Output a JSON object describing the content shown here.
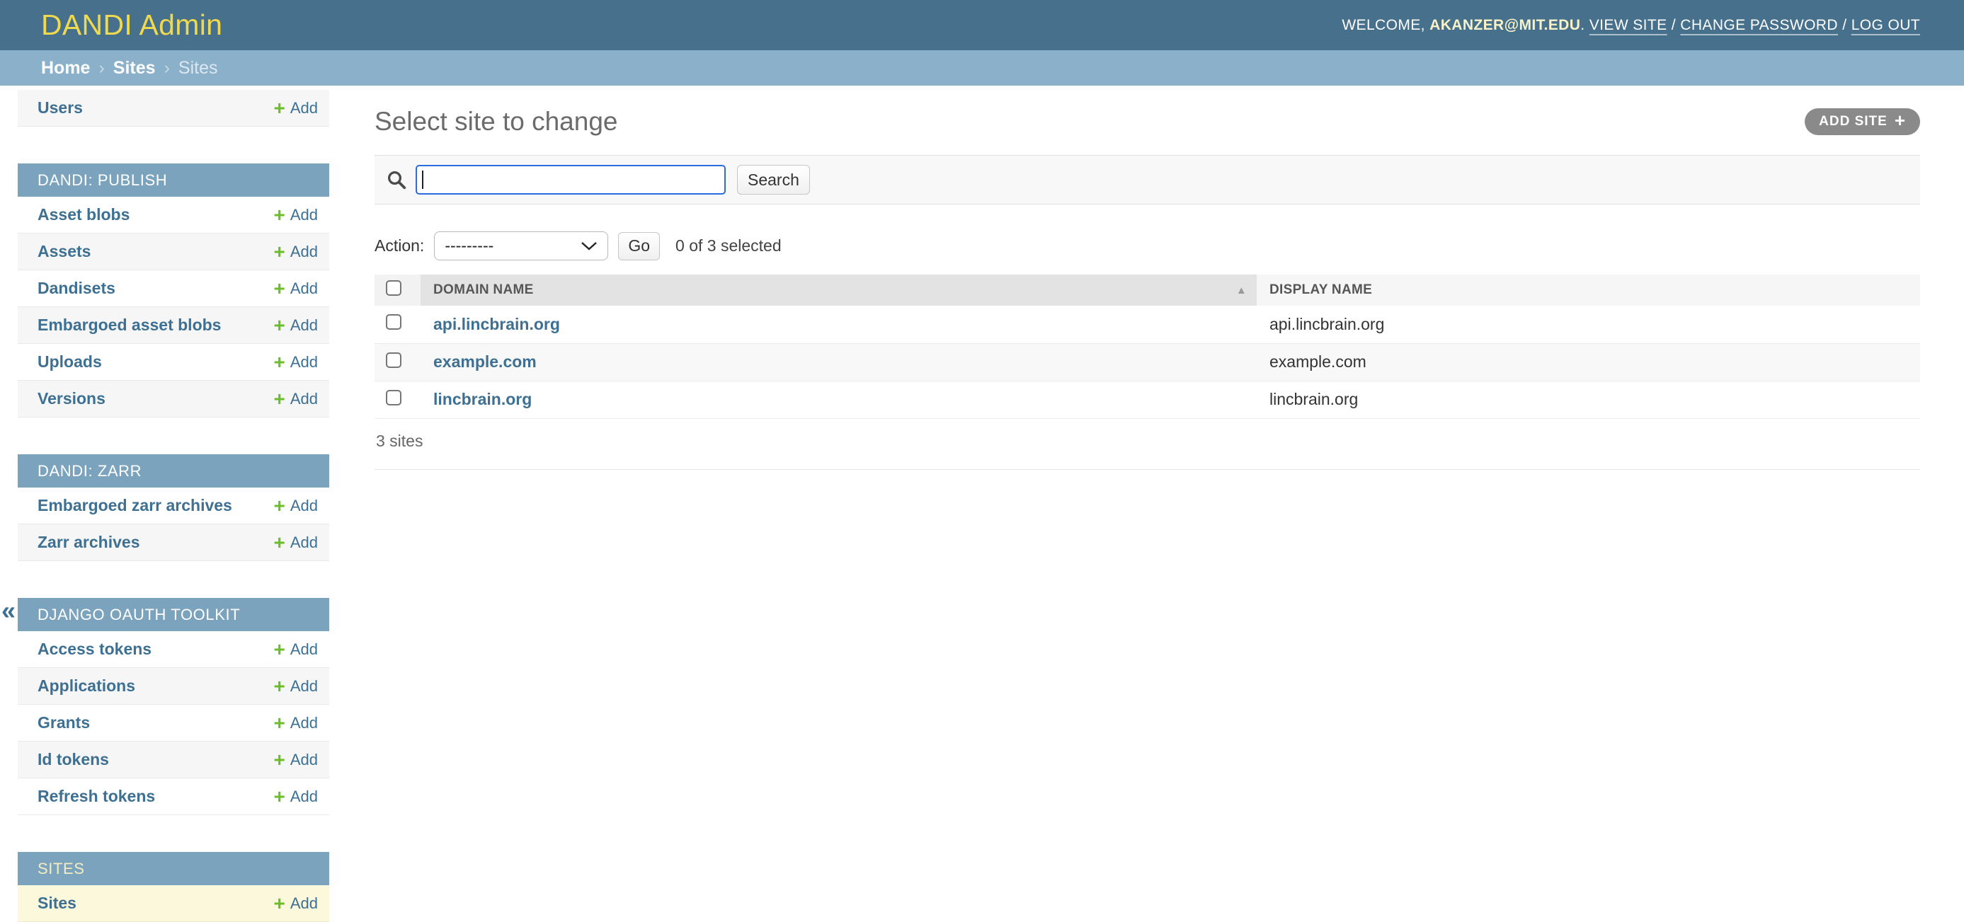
{
  "header": {
    "brand": "DANDI Admin",
    "welcome_prefix": "WELCOME,",
    "username": "AKANZER@MIT.EDU",
    "after_username": ".",
    "link_view_site": "VIEW SITE",
    "link_change_password": "CHANGE PASSWORD",
    "link_log_out": "LOG OUT",
    "link_separator": "/"
  },
  "breadcrumbs": {
    "home": "Home",
    "section": "Sites",
    "current": "Sites",
    "separator": "›"
  },
  "sidebar": {
    "toggle": "«",
    "plus": "+",
    "add_label": "Add",
    "sections": [
      {
        "caption": "",
        "items": [
          {
            "label": "Users"
          }
        ]
      },
      {
        "caption": "DANDI: PUBLISH",
        "items": [
          {
            "label": "Asset blobs"
          },
          {
            "label": "Assets"
          },
          {
            "label": "Dandisets"
          },
          {
            "label": "Embargoed asset blobs"
          },
          {
            "label": "Uploads"
          },
          {
            "label": "Versions"
          }
        ]
      },
      {
        "caption": "DANDI: ZARR",
        "items": [
          {
            "label": "Embargoed zarr archives"
          },
          {
            "label": "Zarr archives"
          }
        ]
      },
      {
        "caption": "DJANGO OAUTH TOOLKIT",
        "items": [
          {
            "label": "Access tokens"
          },
          {
            "label": "Applications"
          },
          {
            "label": "Grants"
          },
          {
            "label": "Id tokens"
          },
          {
            "label": "Refresh tokens"
          }
        ]
      },
      {
        "caption": "SITES",
        "items": [
          {
            "label": "Sites"
          }
        ]
      }
    ]
  },
  "main": {
    "title": "Select site to change",
    "add_button": {
      "label": "ADD SITE",
      "icon": "+"
    },
    "search": {
      "value": "",
      "placeholder": "",
      "button_label": "Search"
    },
    "actions": {
      "label": "Action:",
      "selected_option": "---------",
      "go_label": "Go",
      "counter": "0 of 3 selected"
    },
    "table": {
      "col_domain": "DOMAIN NAME",
      "col_display": "DISPLAY NAME",
      "sort_icon": "▲",
      "rows": [
        {
          "domain": "api.lincbrain.org",
          "display": "api.lincbrain.org"
        },
        {
          "domain": "example.com",
          "display": "example.com"
        },
        {
          "domain": "lincbrain.org",
          "display": "lincbrain.org"
        }
      ]
    },
    "pagination": "3 sites"
  },
  "colors": {
    "header_bg": "#46708c",
    "breadcrumb_bg": "#8bb0c9",
    "caption_bg": "#7ca3bd",
    "brand_yellow": "#eed94f",
    "link_blue": "#3d7092",
    "add_green": "#6abf28",
    "selected_row_yellow": "#fcf8dc",
    "focus_border_blue": "#2a6ce0",
    "sorted_header_bg": "#e3e3e3"
  }
}
